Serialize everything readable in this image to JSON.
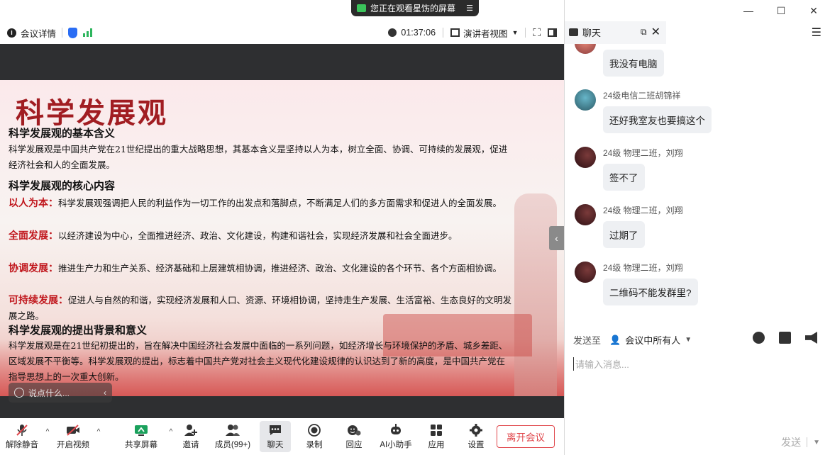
{
  "banner": {
    "text": "您正在观看星饬的屏幕",
    "menu_icon": "☰"
  },
  "window": {
    "minimize": "—",
    "maximize": "☐",
    "close": "✕"
  },
  "topbar": {
    "meeting_details": "会议详情",
    "timer": "01:37:06",
    "presenter_view": "演讲者视图"
  },
  "chat_header": {
    "title": "聊天"
  },
  "slide": {
    "title": "科学发展观",
    "sec1_heading": "科学发展观的基本含义",
    "sec1_text": "科学发展观是中国共产党在21世纪提出的重大战略思想，其基本含义是坚持以人为本，树立全面、协调、可持续的发展观，促进经济社会和人的全面发展。",
    "sec2_heading": "科学发展观的核心内容",
    "item1_label": "以人为本：",
    "item1_text": "科学发展观强调把人民的利益作为一切工作的出发点和落脚点，不断满足人们的多方面需求和促进人的全面发展。",
    "item2_label": "全面发展：",
    "item2_text": "以经济建设为中心，全面推进经济、政治、文化建设，构建和谐社会，实现经济发展和社会全面进步。",
    "item3_label": "协调发展：",
    "item3_text": "推进生产力和生产关系、经济基础和上层建筑相协调，推进经济、政治、文化建设的各个环节、各个方面相协调。",
    "item4_label": "可持续发展：",
    "item4_text": "促进人与自然的和谐，实现经济发展和人口、资源、环境相协调，坚持走生产发展、生活富裕、生态良好的文明发展之路。",
    "sec3_heading": "科学发展观的提出背景和意义",
    "sec3_text": "科学发展观是在21世纪初提出的，旨在解决中国经济社会发展中面临的一系列问题，如经济增长与环境保护的矛盾、城乡差距、区域发展不平衡等。科学发展观的提出，标志着中国共产党对社会主义现代化建设规律的认识达到了新的高度，是中国共产党在指导思想上的一次重大创新。"
  },
  "chat_float": {
    "placeholder": "说点什么..."
  },
  "toolbar": {
    "unmute": "解除静音",
    "start_video": "开启视频",
    "share_screen": "共享屏幕",
    "invite": "邀请",
    "members": "成员(99+)",
    "chat": "聊天",
    "record": "录制",
    "react": "回应",
    "ai_assistant": "AI小助手",
    "apps": "应用",
    "settings": "设置",
    "leave": "离开会议"
  },
  "messages": [
    {
      "name": "",
      "text": "我没有电脑"
    },
    {
      "name": "24级电信二班胡锦祥",
      "text": "还好我室友也要搞这个"
    },
    {
      "name": "24级 物理二班，刘翔",
      "text": "签不了"
    },
    {
      "name": "24级 物理二班，刘翔",
      "text": "过期了"
    },
    {
      "name": "24级 物理二班，刘翔",
      "text": "二维码不能发群里?"
    }
  ],
  "chat_input": {
    "send_to_label": "发送至",
    "recipient": "会议中所有人",
    "placeholder": "请输入消息...",
    "send": "发送"
  }
}
